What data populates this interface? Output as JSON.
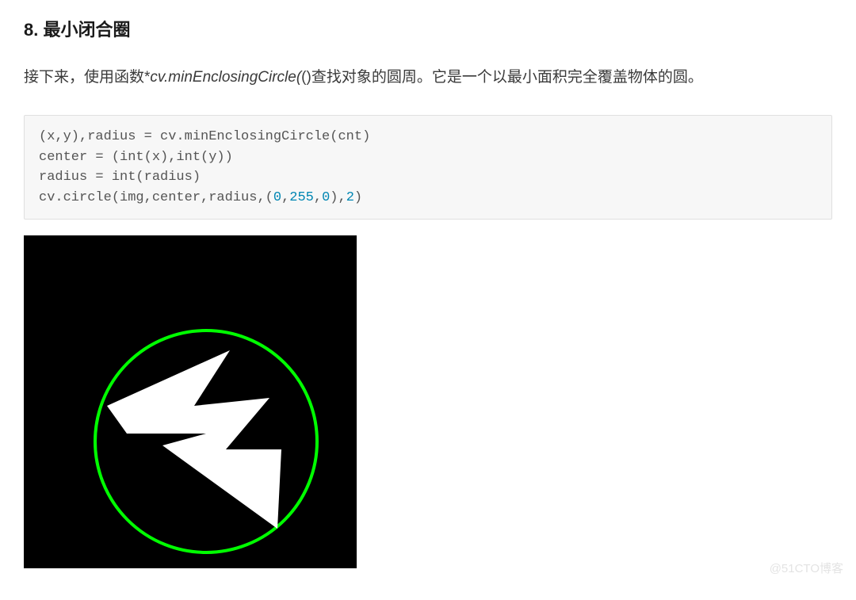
{
  "heading": "8. 最小闭合圈",
  "paragraph": {
    "before": "接下来，使用函数*",
    "func": "cv.minEnclosingCircle(",
    "after": "()查找对象的圆周。它是一个以最小面积完全覆盖物体的圆。"
  },
  "code": {
    "line1": "(x,y),radius = cv.minEnclosingCircle(cnt)",
    "line2": "center = (int(x),int(y))",
    "line3": "radius = int(radius)",
    "line4_prefix": "cv.circle(img,center,radius,(",
    "line4_n1": "0",
    "line4_c1": ",",
    "line4_n2": "255",
    "line4_c2": ",",
    "line4_n3": "0",
    "line4_mid": "),",
    "line4_n4": "2",
    "line4_suffix": ")"
  },
  "watermark": "@51CTO博客",
  "circle": {
    "color": "#00ff00"
  }
}
